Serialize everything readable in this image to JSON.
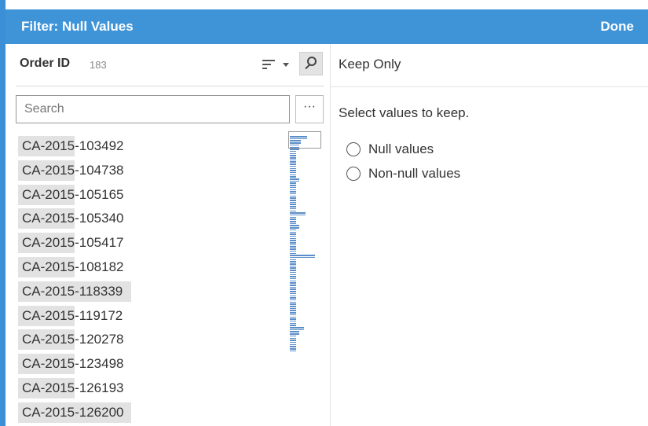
{
  "dialog": {
    "title": "Filter: Null Values",
    "done_label": "Done",
    "accent_color": "#3f94d8"
  },
  "left_pane": {
    "field_name": "Order ID",
    "field_count": "183",
    "search_placeholder": "Search",
    "more_label": "···",
    "values": [
      {
        "label": "CA-2015-103492",
        "bar_fraction": 0.33
      },
      {
        "label": "CA-2015-104738",
        "bar_fraction": 0.33
      },
      {
        "label": "CA-2015-105165",
        "bar_fraction": 0.33
      },
      {
        "label": "CA-2015-105340",
        "bar_fraction": 0.33
      },
      {
        "label": "CA-2015-105417",
        "bar_fraction": 0.33
      },
      {
        "label": "CA-2015-108182",
        "bar_fraction": 0.33
      },
      {
        "label": "CA-2015-118339",
        "bar_fraction": 0.66
      },
      {
        "label": "CA-2015-119172",
        "bar_fraction": 0.33
      },
      {
        "label": "CA-2015-120278",
        "bar_fraction": 0.33
      },
      {
        "label": "CA-2015-123498",
        "bar_fraction": 0.33
      },
      {
        "label": "CA-2015-126193",
        "bar_fraction": 0.33
      },
      {
        "label": "CA-2015-126200",
        "bar_fraction": 0.66
      }
    ]
  },
  "right_pane": {
    "title": "Keep Only",
    "instruction": "Select values to keep.",
    "options": [
      {
        "label": "Null values",
        "selected": false
      },
      {
        "label": "Non-null values",
        "selected": false
      }
    ]
  }
}
